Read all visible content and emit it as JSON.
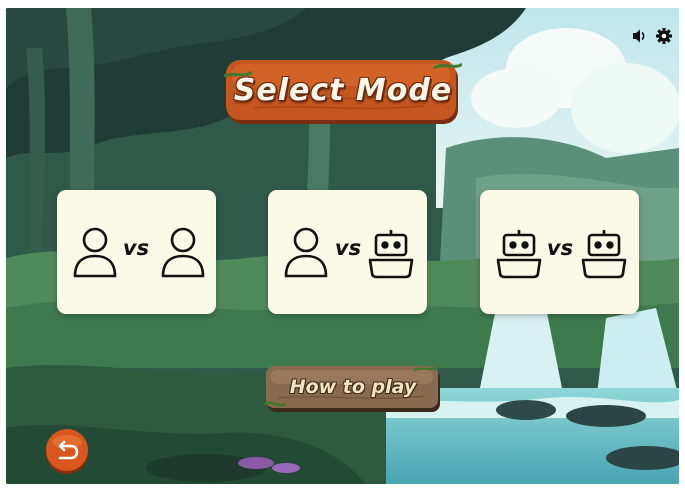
{
  "title": "Select Mode",
  "modes": [
    {
      "left": "person-icon",
      "vs": "vs",
      "right": "person-icon"
    },
    {
      "left": "person-icon",
      "vs": "vs",
      "right": "robot-icon"
    },
    {
      "left": "robot-icon",
      "vs": "vs",
      "right": "robot-icon"
    }
  ],
  "how_to_play_label": "How to play",
  "icons": {
    "sound": "speaker-icon",
    "settings": "gear-icon",
    "back": "back-arrow-icon"
  },
  "colors": {
    "card": "#fbfae6",
    "sign_wood": "#c4561f",
    "howto_wood": "#8a6a4f",
    "back_button": "#d9571f"
  }
}
